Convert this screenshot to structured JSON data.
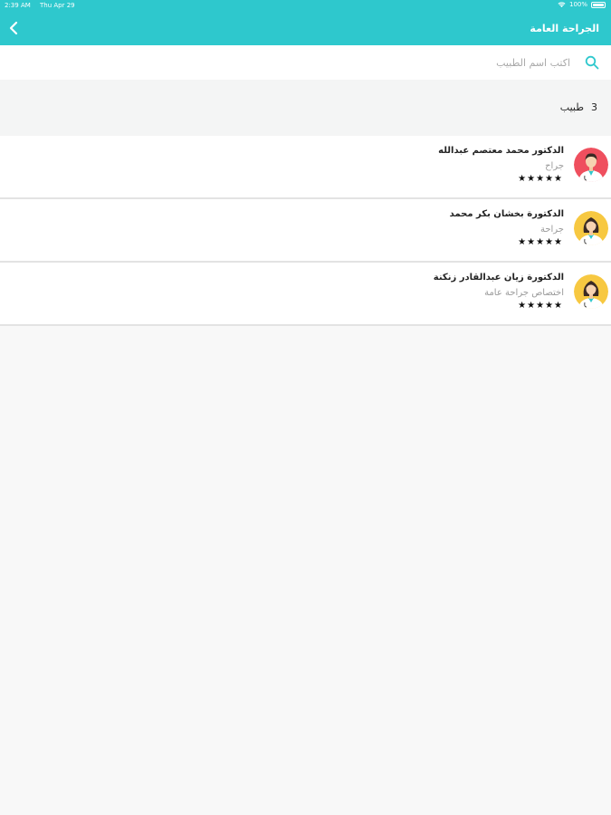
{
  "status_bar": {
    "time": "2:39 AM",
    "date": "Thu Apr 29",
    "battery": "100%"
  },
  "header": {
    "title": "الجراحة العامة",
    "accent_color": "#2ec8cd"
  },
  "search": {
    "placeholder": "اكتب اسم الطبيب",
    "value": ""
  },
  "count": {
    "number": "3",
    "label": "طبيب"
  },
  "doctors": [
    {
      "name": "الدكتور محمد معتصم عبدالله",
      "specialty": "جراح",
      "stars": "★★★★★",
      "rating": 5,
      "avatar": "male-doctor-avatar",
      "avatar_color": "#ef4f5e"
    },
    {
      "name": "الدكتورة بخشان بكر محمد",
      "specialty": "جراحة",
      "stars": "★★★★★",
      "rating": 5,
      "avatar": "female-doctor-avatar",
      "avatar_color": "#f7c841"
    },
    {
      "name": "الدكتورة زيان عبدالقادر زنكنة",
      "specialty": "اختصاص جراحة عامة",
      "stars": "★★★★★",
      "rating": 5,
      "avatar": "female-doctor-avatar",
      "avatar_color": "#f7c841"
    }
  ]
}
